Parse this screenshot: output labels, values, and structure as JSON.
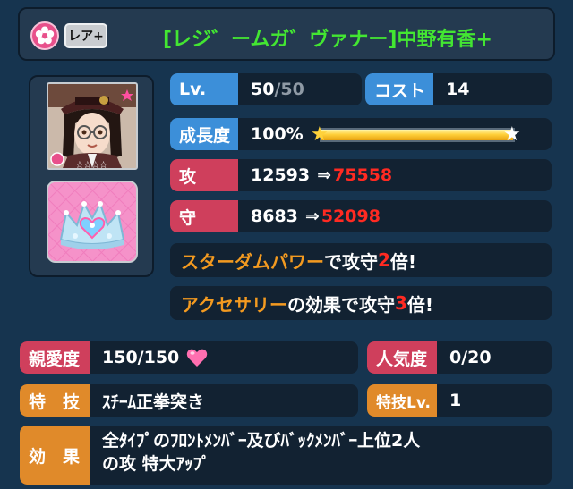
{
  "header": {
    "rarity_label": "レア+",
    "card_name": "[レジ゛ームガ゛ヴァナー]中野有香+"
  },
  "portrait": {
    "rarity_stars": "☆☆☆☆"
  },
  "stats": {
    "level": {
      "label": "Lv.",
      "current": "50",
      "sep_max": "/50"
    },
    "cost": {
      "label": "コスト",
      "value": "14"
    },
    "growth": {
      "label": "成長度",
      "value": "100%",
      "fill_fraction": 1.0
    },
    "attack": {
      "label": "攻",
      "base": "12593",
      "arrow": "⇒",
      "boosted": "75558"
    },
    "defense": {
      "label": "守",
      "base": "8683",
      "arrow": "⇒",
      "boosted": "52098"
    }
  },
  "messages": {
    "stardom": {
      "highlight": "スターダムパワー",
      "pre": "で攻守",
      "mult": "2",
      "post": "倍!"
    },
    "accessory": {
      "highlight": "アクセサリー",
      "pre": "の効果で攻守",
      "mult": "3",
      "post": "倍!"
    }
  },
  "info": {
    "affection": {
      "label": "親愛度",
      "value": "150/150"
    },
    "popularity": {
      "label": "人気度",
      "value": "0/20"
    },
    "skill": {
      "label": "特　技",
      "value": "ｽﾁｰﾑ正拳突き"
    },
    "skill_level": {
      "label": "特技Lv.",
      "value": "1"
    },
    "effect": {
      "label": "効　果",
      "line1": "全ﾀｲﾌﾟのﾌﾛﾝﾄﾒﾝﾊﾞｰ及びﾊﾞｯｸﾒﾝﾊﾞｰ上位2人",
      "line2": "の攻 特大ｱｯﾌﾟ"
    }
  },
  "colors": {
    "card_name": "#43e632",
    "label_blue": "#3c8fd9",
    "label_red": "#cf3f5c",
    "label_orange": "#e08a2a",
    "highlight_orange": "#f39a20",
    "boost_red": "#ff2a22",
    "heart": "#ff6fb0"
  },
  "icons": {
    "rarity_emblem": "flower-icon",
    "affection": "heart-icon",
    "bar_ends": "star-icon"
  }
}
